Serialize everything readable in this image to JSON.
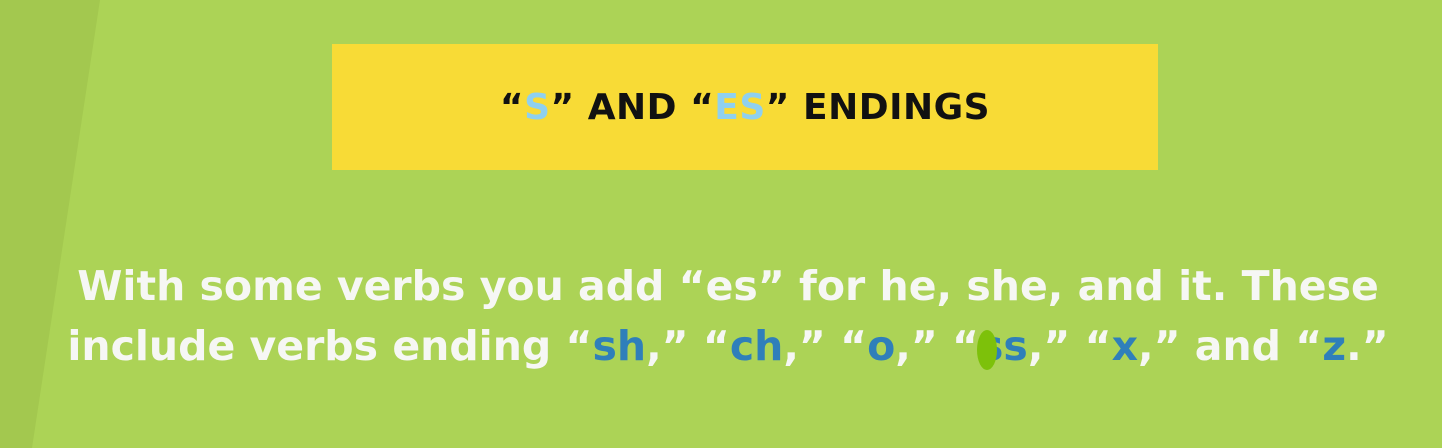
{
  "title": {
    "q1_open": "“",
    "s": "S",
    "q1_close": "” AND “",
    "es": "ES",
    "q1_end": "” ENDINGS"
  },
  "body": {
    "line1": "With some verbs you add “es” for he, she, and it. These",
    "line2_prefix": "include verbs ending “",
    "endings": [
      "sh",
      "ch",
      "o",
      "ss",
      "x",
      "z"
    ],
    "sep": ",” “",
    "and": ",” and “",
    "end": ".”"
  },
  "colors": {
    "background": "#acd356",
    "title_box": "#f8db36",
    "highlight": "#2f7fba",
    "title_accent": "#8fd0ef"
  }
}
